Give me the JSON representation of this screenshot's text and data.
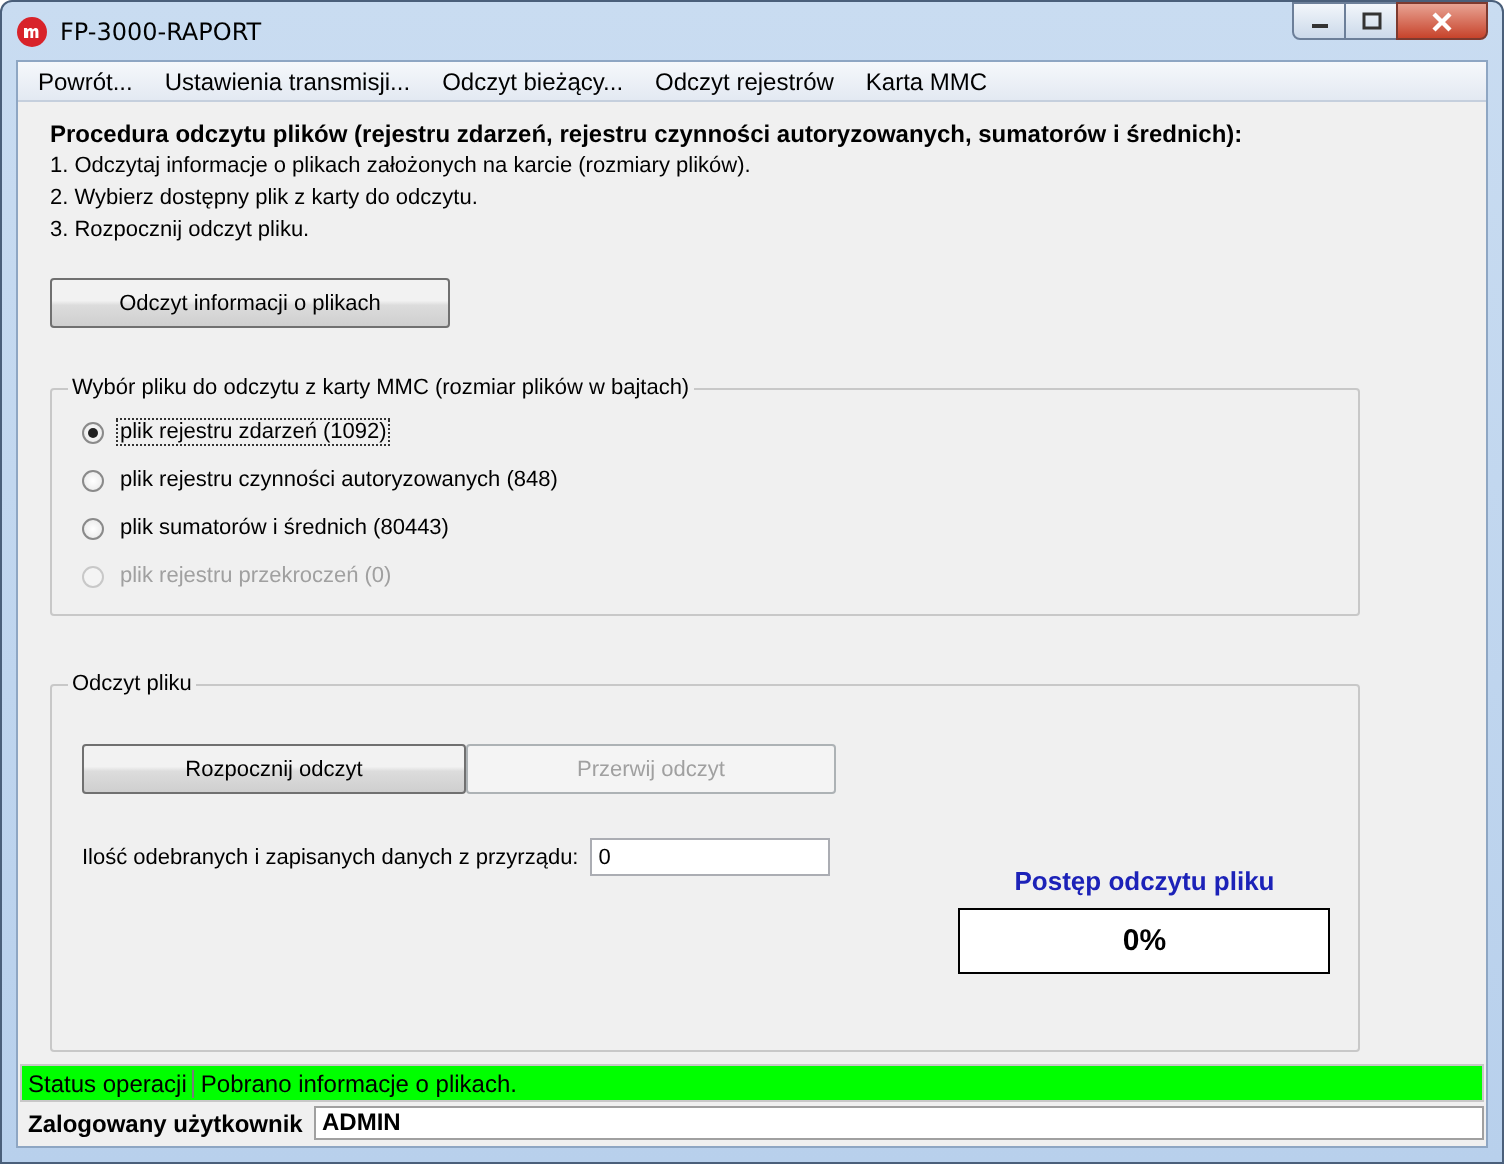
{
  "window": {
    "title": "FP-3000-RAPORT"
  },
  "menu": [
    {
      "label": "Powrót..."
    },
    {
      "label": "Ustawienia transmisji..."
    },
    {
      "label": "Odczyt bieżący..."
    },
    {
      "label": "Odczyt rejestrów"
    },
    {
      "label": "Karta MMC"
    }
  ],
  "instructions": {
    "heading": "Procedura odczytu plików (rejestru zdarzeń, rejestru czynności autoryzowanych, sumatorów i średnich):",
    "steps": [
      "1. Odczytaj informacje o plikach założonych na karcie (rozmiary plików).",
      "2. Wybierz dostępny plik z karty do odczytu.",
      "3. Rozpocznij odczyt pliku."
    ]
  },
  "info_button": {
    "label": "Odczyt informacji o plikach"
  },
  "file_group": {
    "title": "Wybór pliku do odczytu z karty MMC (rozmiar plików w bajtach)",
    "options": [
      {
        "label": "plik rejestru zdarzeń (1092)",
        "selected": true,
        "disabled": false
      },
      {
        "label": "plik rejestru czynności autoryzowanych (848)",
        "selected": false,
        "disabled": false
      },
      {
        "label": "plik sumatorów i średnich (80443)",
        "selected": false,
        "disabled": false
      },
      {
        "label": "plik rejestru przekroczeń (0)",
        "selected": false,
        "disabled": true
      }
    ]
  },
  "read_group": {
    "title": "Odczyt pliku",
    "buttons": [
      {
        "label": "Rozpocznij odczyt",
        "disabled": false
      },
      {
        "label": "Przerwij odczyt",
        "disabled": true
      }
    ],
    "count_label": "Ilość odebranych i zapisanych danych z przyrządu:",
    "count_value": "0",
    "progress_title": "Postęp odczytu pliku",
    "progress_text": "0%"
  },
  "status": {
    "label": "Status operacji",
    "message": "Pobrano informacje o plikach."
  },
  "user": {
    "label": "Zalogowany użytkownik",
    "value": "ADMIN"
  }
}
